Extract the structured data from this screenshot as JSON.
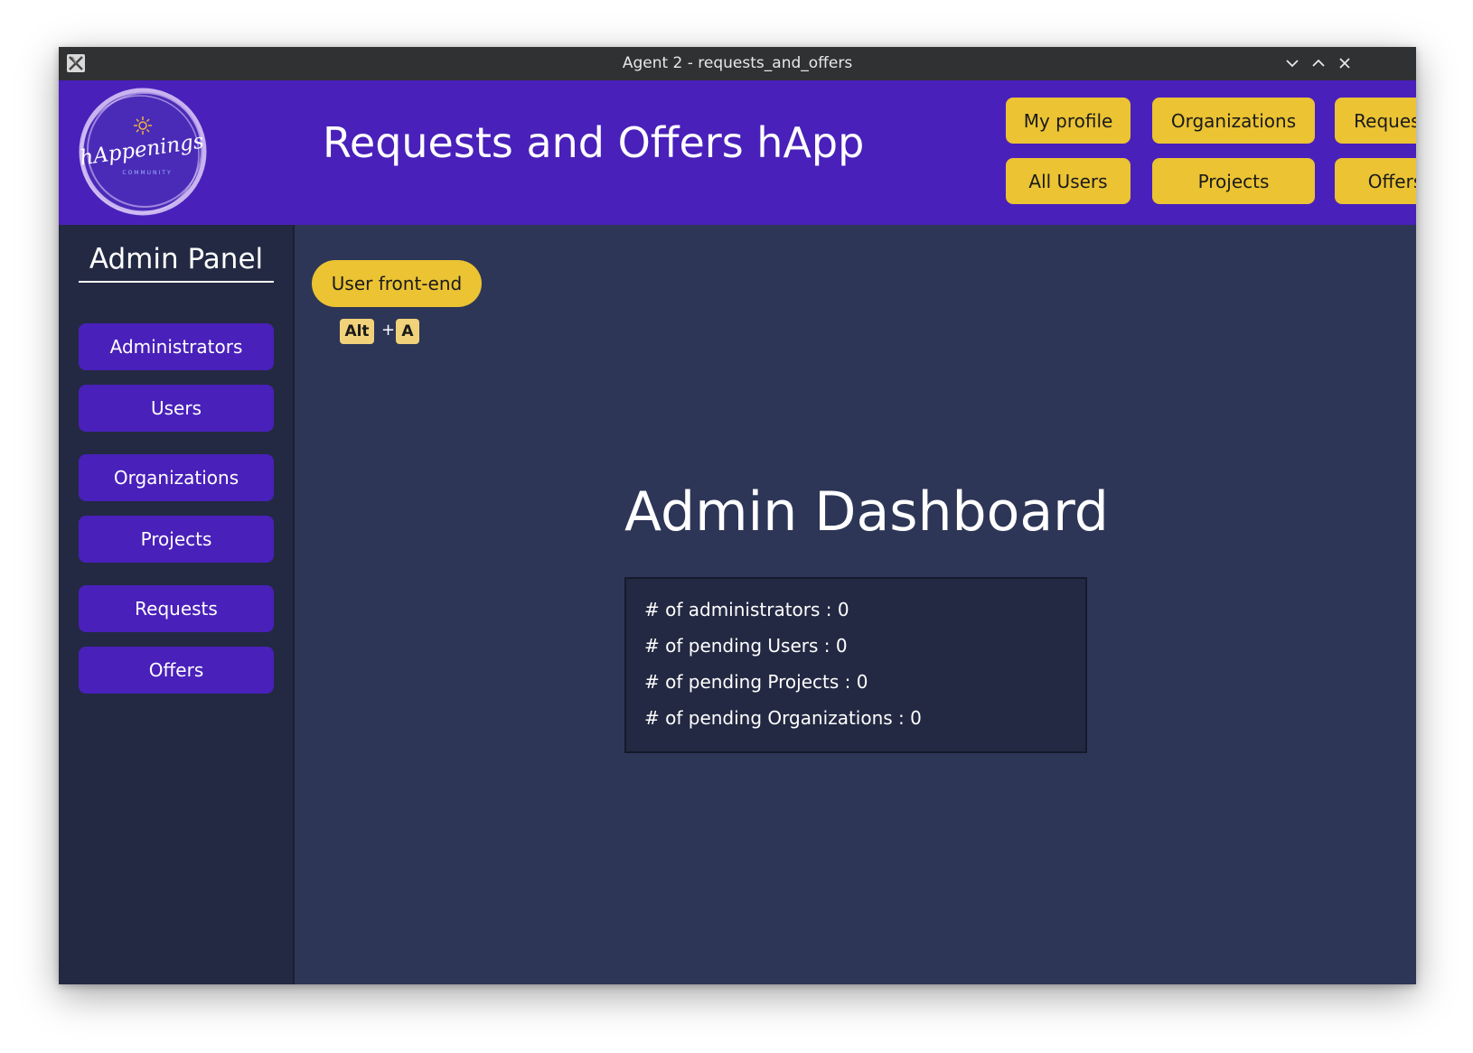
{
  "window": {
    "title": "Agent 2 - requests_and_offers"
  },
  "header": {
    "logo_text": "hAppenings",
    "logo_subtext": "COMMUNITY",
    "app_title": "Requests and Offers hApp",
    "nav": [
      {
        "label": "My profile"
      },
      {
        "label": "Organizations"
      },
      {
        "label": "Requests"
      },
      {
        "label": "All Users"
      },
      {
        "label": "Projects"
      },
      {
        "label": "Offers"
      }
    ]
  },
  "sidebar": {
    "title": "Admin Panel",
    "items": [
      {
        "label": "Administrators"
      },
      {
        "label": "Users"
      },
      {
        "label": "Organizations"
      },
      {
        "label": "Projects"
      },
      {
        "label": "Requests"
      },
      {
        "label": "Offers"
      }
    ]
  },
  "main": {
    "frontend_button": "User front-end",
    "shortcut": {
      "key1": "Alt",
      "plus": "+",
      "key2": "A"
    },
    "dashboard_title": "Admin Dashboard",
    "stats": [
      {
        "text": "# of administrators : 0"
      },
      {
        "text": "# of pending Users : 0"
      },
      {
        "text": "# of pending Projects : 0"
      },
      {
        "text": "# of pending Organizations : 0"
      }
    ]
  },
  "colors": {
    "header_bg": "#4920ba",
    "accent_yellow": "#ebc333",
    "sidebar_bg": "#232942",
    "main_bg": "#2d3657"
  }
}
